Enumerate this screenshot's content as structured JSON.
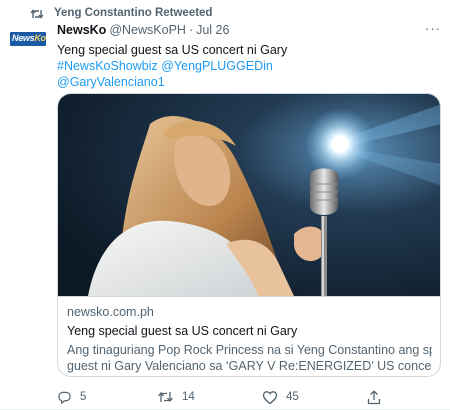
{
  "retweet_banner": {
    "text": "Yeng Constantino Retweeted",
    "icon": "retweet-icon"
  },
  "author": {
    "avatar_logo_part1": "News",
    "avatar_logo_part2": "Ko",
    "name": "NewsKo",
    "handle": "@NewsKoPH",
    "separator": "·",
    "date": "Jul 26"
  },
  "more_label": "···",
  "tweet": {
    "text": "Yeng special guest sa US concert ni Gary",
    "hashtag_line": "#NewsKoShowbiz",
    "mention1": "@YengPLUGGEDin",
    "mention2": "@GaryValenciano1"
  },
  "card": {
    "domain": "newsko.com.ph",
    "title": "Yeng special guest sa US concert ni Gary",
    "desc_line1": "Ang tinaguriang Pop Rock Princess na si Yeng Constantino ang special",
    "desc_line2": "guest ni Gary Valenciano sa ‘GARY V Re:ENERGIZED’ US concert tour..."
  },
  "actions": {
    "reply_count": "5",
    "retweet_count": "14",
    "like_count": "45"
  },
  "colors": {
    "link": "#1d9bf0",
    "secondary_text": "#536471",
    "border": "#cfd9de",
    "avatar_bg": "#1d5aa6"
  }
}
